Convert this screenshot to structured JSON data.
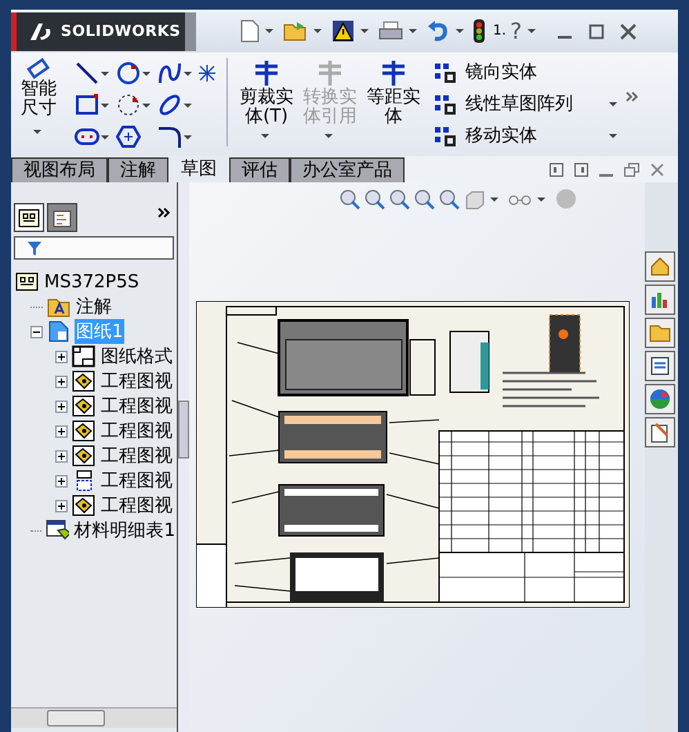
{
  "app": {
    "logo": "SOLIDWORKS",
    "help_label": "1.",
    "help_mark": "?"
  },
  "ribbon": {
    "smart_dimension": "智能尺寸",
    "big_buttons": [
      {
        "label": "剪裁实体(T)",
        "disabled": false
      },
      {
        "label": "转换实体引用",
        "disabled": true
      },
      {
        "label": "等距实体",
        "disabled": false
      }
    ],
    "list_buttons": [
      {
        "label": "镜向实体",
        "has_menu": false
      },
      {
        "label": "线性草图阵列",
        "has_menu": true
      },
      {
        "label": "移动实体",
        "has_menu": true
      }
    ]
  },
  "tabs": [
    {
      "label": "视图布局",
      "selected": false
    },
    {
      "label": "注解",
      "selected": false
    },
    {
      "label": "草图",
      "selected": true
    },
    {
      "label": "评估",
      "selected": false
    },
    {
      "label": "办公室产品",
      "selected": false
    }
  ],
  "tree": {
    "root": "MS372P5S",
    "items": [
      {
        "label": "注解",
        "kind": "annotation",
        "selected": false
      },
      {
        "label": "图纸1",
        "kind": "sheet",
        "selected": true,
        "expanded": true,
        "children": [
          {
            "label": "图纸格式",
            "kind": "format",
            "expanded": false
          },
          {
            "label": "工程图视",
            "kind": "view",
            "expanded": false
          },
          {
            "label": "工程图视",
            "kind": "view",
            "expanded": false
          },
          {
            "label": "工程图视",
            "kind": "view",
            "expanded": false
          },
          {
            "label": "工程图视",
            "kind": "view",
            "expanded": false
          },
          {
            "label": "工程图视",
            "kind": "section",
            "expanded": false
          },
          {
            "label": "工程图视",
            "kind": "view",
            "expanded": false
          }
        ]
      },
      {
        "label": "材料明细表1",
        "kind": "bom",
        "selected": false
      }
    ]
  }
}
